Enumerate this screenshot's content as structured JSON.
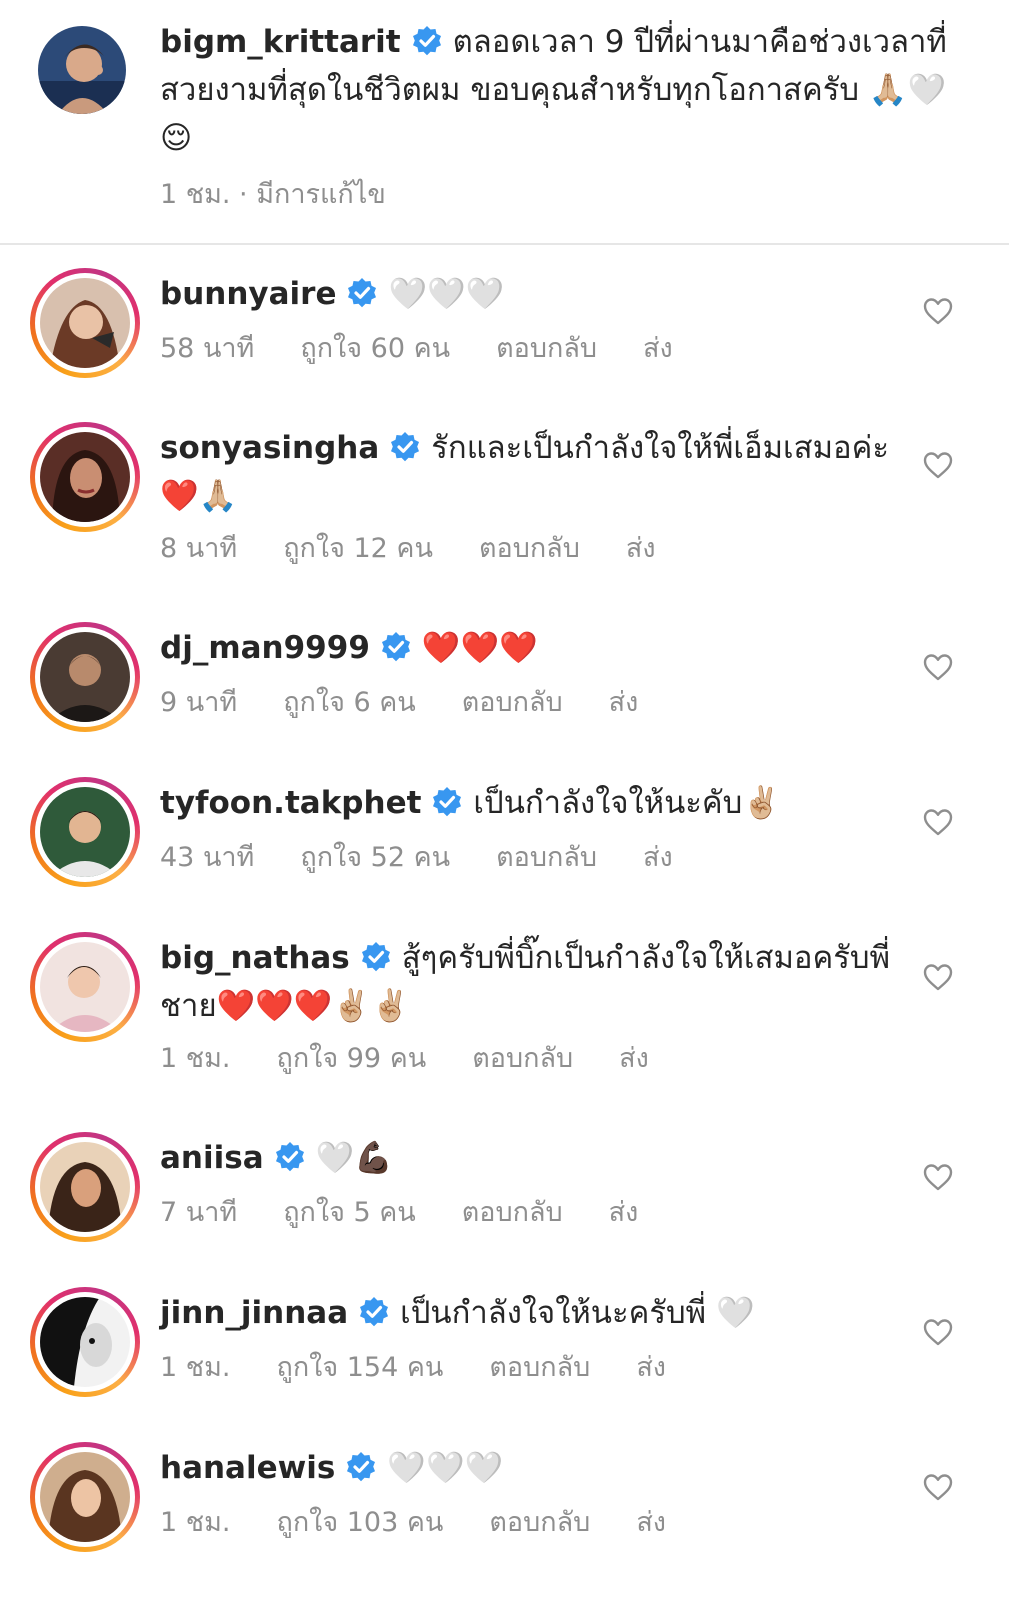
{
  "post": {
    "username": "bigm_krittarit",
    "caption": "ตลอดเวลา 9 ปีที่ผ่านมาคือช่วงเวลาที่สวยงามที่สุดในชีวิตผม ขอบคุณสำหรับทุกโอกาสครับ 🙏🏼🤍😌",
    "meta": "1 ชม. · มีการแก้ไข"
  },
  "labels": {
    "reply": "ตอบกลับ",
    "send": "ส่ง"
  },
  "comments": [
    {
      "username": "bunnyaire",
      "text": "🤍🤍🤍",
      "time": "58 นาที",
      "likes": "ถูกใจ 60 คน",
      "avatar_color": "#b07a63"
    },
    {
      "username": "sonyasingha",
      "text": "รักและเป็นกำลังใจให้พี่เอ็มเสมอค่ะ ❤️🙏🏼",
      "time": "8 นาที",
      "likes": "ถูกใจ 12 คน",
      "avatar_color": "#8a4b3c"
    },
    {
      "username": "dj_man9999",
      "text": "❤️❤️❤️",
      "time": "9 นาที",
      "likes": "ถูกใจ 6 คน",
      "avatar_color": "#3a2f2a"
    },
    {
      "username": "tyfoon.takphet",
      "text": "เป็นกำลังใจให้นะคับ✌🏼",
      "time": "43 นาที",
      "likes": "ถูกใจ 52 คน",
      "avatar_color": "#2f5a3a"
    },
    {
      "username": "big_nathas",
      "text": "สู้ๆครับพี่บิ๊กเป็นกำลังใจให้เสมอครับพี่ชาย❤️❤️❤️✌🏼✌🏼",
      "time": "1 ชม.",
      "likes": "ถูกใจ 99 คน",
      "avatar_color": "#e8c9c4"
    },
    {
      "username": "aniisa",
      "text": "🤍💪🏿",
      "time": "7 นาที",
      "likes": "ถูกใจ 5 คน",
      "avatar_color": "#c98a5a"
    },
    {
      "username": "jinn_jinnaa",
      "text": "เป็นกำลังใจให้นะครับพี่ 🤍",
      "time": "1 ชม.",
      "likes": "ถูกใจ 154 คน",
      "avatar_color": "#1a1a1a"
    },
    {
      "username": "hanalewis",
      "text": "🤍🤍🤍",
      "time": "1 ชม.",
      "likes": "ถูกใจ 103 คน",
      "avatar_color": "#b9855f"
    }
  ],
  "colors": {
    "verified": "#3897f0",
    "muted": "#8e8e8e",
    "text": "#262626"
  }
}
